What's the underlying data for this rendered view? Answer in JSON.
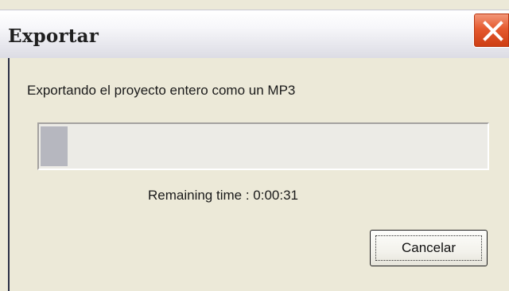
{
  "window": {
    "title": "Exportar"
  },
  "titlebar": {
    "close_icon": "close-icon",
    "close_button_color": "#e55a2f"
  },
  "content": {
    "message": "Exportando el proyecto entero como un MP3",
    "progress_fraction": 0.06,
    "progress_fill_color": "#b6b7bf",
    "remaining_time": "Remaining time : 0:00:31"
  },
  "buttons": {
    "cancel_label": "Cancelar"
  }
}
